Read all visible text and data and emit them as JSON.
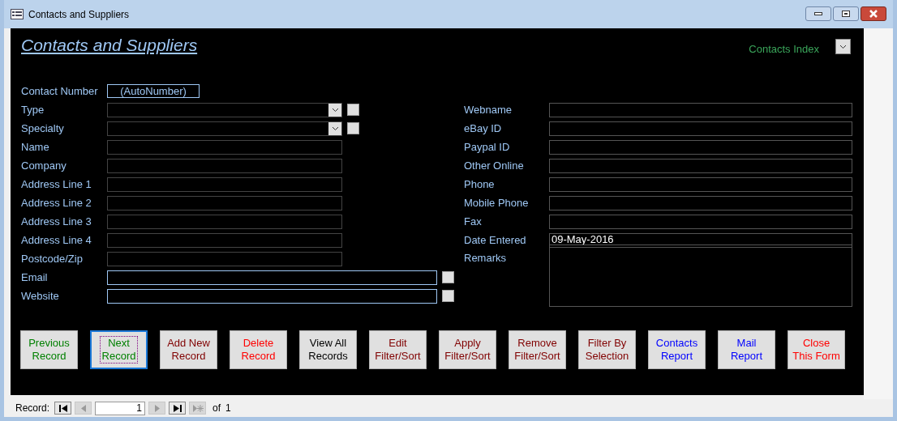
{
  "window": {
    "title": "Contacts and Suppliers"
  },
  "form_title": "Contacts and Suppliers",
  "index_lookup": {
    "label": "Contacts Index"
  },
  "contact_number": {
    "label": "Contact Number",
    "value": "(AutoNumber)"
  },
  "left_fields": [
    {
      "label": "Type",
      "kind": "combo"
    },
    {
      "label": "Specialty",
      "kind": "combo"
    },
    {
      "label": "Name",
      "kind": "text"
    },
    {
      "label": "Company",
      "kind": "text"
    },
    {
      "label": "Address Line 1",
      "kind": "text"
    },
    {
      "label": "Address Line 2",
      "kind": "text"
    },
    {
      "label": "Address Line 3",
      "kind": "text"
    },
    {
      "label": "Address Line 4",
      "kind": "text"
    },
    {
      "label": "Postcode/Zip",
      "kind": "text"
    },
    {
      "label": "Email",
      "kind": "wide"
    },
    {
      "label": "Website",
      "kind": "wide"
    }
  ],
  "right_fields": [
    {
      "label": "Webname",
      "kind": "text"
    },
    {
      "label": "eBay ID",
      "kind": "text"
    },
    {
      "label": "Paypal ID",
      "kind": "text"
    },
    {
      "label": "Other Online",
      "kind": "text"
    },
    {
      "label": "Phone",
      "kind": "text"
    },
    {
      "label": "Mobile Phone",
      "kind": "text"
    },
    {
      "label": "Fax",
      "kind": "text"
    },
    {
      "label": "Date Entered",
      "kind": "text",
      "value": "09-May-2016"
    },
    {
      "label": "Remarks",
      "kind": "memo"
    }
  ],
  "buttons": [
    {
      "lines": [
        "Previous",
        "Record"
      ],
      "color": "#008000",
      "selected": false
    },
    {
      "lines": [
        "Next",
        "Record"
      ],
      "color": "#008000",
      "selected": true
    },
    {
      "lines": [
        "Add New",
        "Record"
      ],
      "color": "#800000",
      "selected": false
    },
    {
      "lines": [
        "Delete",
        "Record"
      ],
      "color": "#ff0000",
      "selected": false
    },
    {
      "lines": [
        "View All",
        "Records"
      ],
      "color": "#000000",
      "selected": false
    },
    {
      "lines": [
        "Edit",
        "Filter/Sort"
      ],
      "color": "#800000",
      "selected": false
    },
    {
      "lines": [
        "Apply",
        "Filter/Sort"
      ],
      "color": "#800000",
      "selected": false
    },
    {
      "lines": [
        "Remove",
        "Filter/Sort"
      ],
      "color": "#800000",
      "selected": false
    },
    {
      "lines": [
        "Filter By",
        "Selection"
      ],
      "color": "#800000",
      "selected": false
    },
    {
      "lines": [
        "Contacts",
        "Report"
      ],
      "color": "#0000ff",
      "selected": false
    },
    {
      "lines": [
        "Mail",
        "Report"
      ],
      "color": "#0000ff",
      "selected": false
    },
    {
      "lines": [
        "Close",
        "This Form"
      ],
      "color": "#ff0000",
      "selected": false
    }
  ],
  "record_bar": {
    "label": "Record:",
    "current": "1",
    "of": "of",
    "total": "1",
    "nav": [
      {
        "kind": "first",
        "disabled": false
      },
      {
        "kind": "prev",
        "disabled": true
      },
      {
        "kind": "next",
        "disabled": true
      },
      {
        "kind": "last",
        "disabled": false
      },
      {
        "kind": "new",
        "disabled": true
      }
    ]
  }
}
